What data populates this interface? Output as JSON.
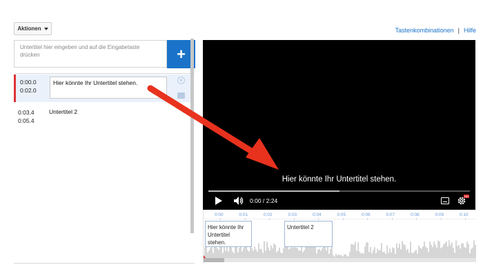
{
  "toolbar": {
    "actions_label": "Aktionen"
  },
  "top_links": {
    "shortcuts": "Tastenkombinationen",
    "separator": "|",
    "help": "Hilfe"
  },
  "editor": {
    "input_placeholder": "Untertitel hier eingeben und auf die Eingabetaste drücken",
    "add_button": "+"
  },
  "cues": [
    {
      "start": "0:00.0",
      "end": "0:02.0",
      "text": "Hier könnte Ihr Untertitel stehen."
    },
    {
      "start": "0:03.4",
      "end": "0:05.4",
      "text": "Untertitel 2"
    }
  ],
  "player": {
    "caption": "Hier könnte Ihr Untertitel stehen.",
    "time_display": "0:00 / 2:24",
    "progress_fraction": 0.5,
    "hd_badge": "HD"
  },
  "timeline": {
    "ticks": [
      "0:00",
      "0:01",
      "0:02",
      "0:03",
      "0:04",
      "0:05",
      "0:06",
      "0:07",
      "0:08",
      "0:09",
      "0:10",
      "0:11"
    ],
    "cue_blocks": [
      {
        "text": "Hier könnte Ihr Untertitel stehen."
      },
      {
        "text": "Untertitel 2"
      }
    ]
  },
  "colors": {
    "accent": "#1a73c8",
    "annotation_arrow": "#e8321e",
    "active_marker": "#dd3333"
  }
}
